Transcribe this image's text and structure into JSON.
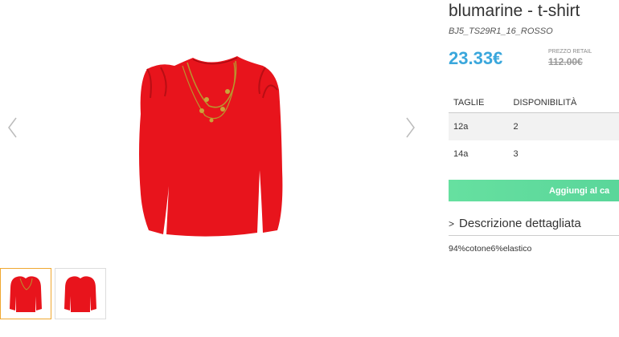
{
  "product": {
    "title": "blumarine - t-shirt",
    "code": "BJ5_TS29R1_16_ROSSO",
    "price": "23.33€",
    "retail_label": "PREZZO RETAIL",
    "retail_price": "112.00€",
    "color": "#e8141c"
  },
  "sizes": {
    "headers": [
      "TAGLIE",
      "DISPONIBILITÀ"
    ],
    "rows": [
      {
        "size": "12a",
        "availability": "2"
      },
      {
        "size": "14a",
        "availability": "3"
      }
    ]
  },
  "cart_button": "Aggiungi al ca",
  "description": {
    "toggle_label": "Descrizione dettagliata",
    "text": "94%cotone6%elastico"
  },
  "colors": {
    "accent_price": "#3aa7dc",
    "cart_green": "#5ad69a"
  }
}
